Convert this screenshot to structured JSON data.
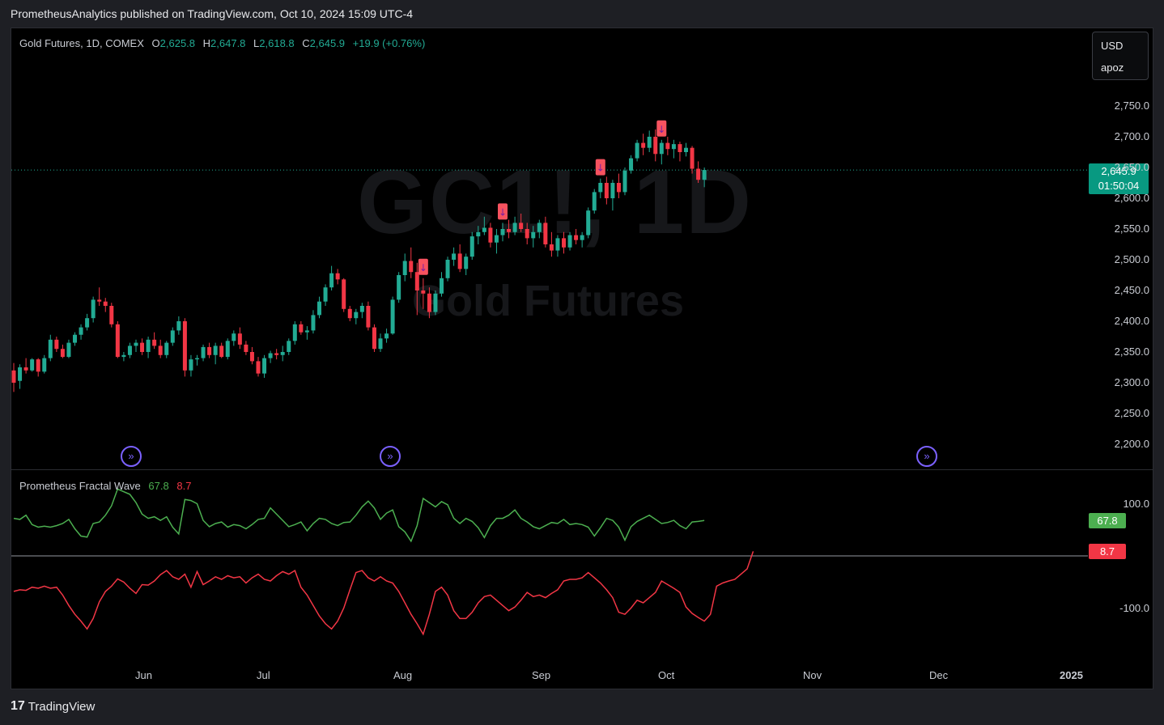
{
  "header": {
    "publish_text": "PrometheusAnalytics published on TradingView.com, Oct 10, 2024 15:09 UTC-4"
  },
  "legend": {
    "symbol": "Gold Futures, 1D, COMEX",
    "o_label": "O",
    "o": "2,625.8",
    "h_label": "H",
    "h": "2,647.8",
    "l_label": "L",
    "l": "2,618.8",
    "c_label": "C",
    "c": "2,645.9",
    "change": "+19.9 (+0.76%)"
  },
  "currency_box": {
    "currency": "USD",
    "mode": "apoz"
  },
  "watermark": {
    "ticker": "GC1!, 1D",
    "name": "Gold Futures"
  },
  "price_axis": [
    "2,750.0",
    "2,700.0",
    "2,650.0",
    "2,600.0",
    "2,550.0",
    "2,500.0",
    "2,450.0",
    "2,400.0",
    "2,350.0",
    "2,300.0",
    "2,250.0",
    "2,200.0"
  ],
  "last_price": {
    "value": "2,645.9",
    "countdown": "01:50:04"
  },
  "time_axis": [
    "Jun",
    "Jul",
    "Aug",
    "Sep",
    "Oct",
    "Nov",
    "Dec",
    "2025"
  ],
  "oscillator": {
    "name": "Prometheus Fractal Wave",
    "green_value": "67.8",
    "red_value": "8.7",
    "axis": [
      "100.0",
      "-100.0"
    ]
  },
  "footer": {
    "brand": "TradingView",
    "logo_text": "17"
  },
  "colors": {
    "up": "#22ab94",
    "down": "#f23645",
    "osc_green": "#4caf50",
    "osc_red": "#f23645",
    "marker": "#7b61ff",
    "zero_line": "#9598a1"
  },
  "chart_data": {
    "type": "candlestick",
    "price_range": [
      2180,
      2780
    ],
    "candles": [
      [
        2320,
        2332,
        2285,
        2300
      ],
      [
        2303,
        2330,
        2290,
        2325
      ],
      [
        2325,
        2340,
        2315,
        2320
      ],
      [
        2320,
        2340,
        2318,
        2338
      ],
      [
        2338,
        2340,
        2310,
        2318
      ],
      [
        2318,
        2345,
        2315,
        2340
      ],
      [
        2340,
        2378,
        2335,
        2370
      ],
      [
        2370,
        2375,
        2350,
        2355
      ],
      [
        2355,
        2362,
        2340,
        2342
      ],
      [
        2342,
        2370,
        2340,
        2365
      ],
      [
        2365,
        2382,
        2360,
        2378
      ],
      [
        2378,
        2395,
        2370,
        2390
      ],
      [
        2390,
        2412,
        2385,
        2405
      ],
      [
        2405,
        2440,
        2398,
        2435
      ],
      [
        2435,
        2455,
        2425,
        2432
      ],
      [
        2432,
        2438,
        2415,
        2425
      ],
      [
        2425,
        2430,
        2390,
        2395
      ],
      [
        2395,
        2400,
        2340,
        2342
      ],
      [
        2342,
        2350,
        2335,
        2345
      ],
      [
        2345,
        2365,
        2340,
        2360
      ],
      [
        2360,
        2370,
        2350,
        2365
      ],
      [
        2365,
        2372,
        2345,
        2350
      ],
      [
        2350,
        2375,
        2340,
        2370
      ],
      [
        2370,
        2382,
        2355,
        2360
      ],
      [
        2360,
        2370,
        2340,
        2345
      ],
      [
        2345,
        2368,
        2340,
        2365
      ],
      [
        2365,
        2390,
        2360,
        2385
      ],
      [
        2385,
        2408,
        2378,
        2400
      ],
      [
        2400,
        2405,
        2310,
        2320
      ],
      [
        2320,
        2345,
        2310,
        2338
      ],
      [
        2338,
        2345,
        2328,
        2340
      ],
      [
        2340,
        2362,
        2335,
        2358
      ],
      [
        2358,
        2365,
        2340,
        2345
      ],
      [
        2345,
        2365,
        2330,
        2360
      ],
      [
        2360,
        2365,
        2340,
        2342
      ],
      [
        2342,
        2372,
        2338,
        2368
      ],
      [
        2368,
        2385,
        2360,
        2380
      ],
      [
        2380,
        2390,
        2355,
        2362
      ],
      [
        2362,
        2368,
        2345,
        2350
      ],
      [
        2350,
        2358,
        2330,
        2335
      ],
      [
        2335,
        2342,
        2310,
        2315
      ],
      [
        2315,
        2345,
        2308,
        2340
      ],
      [
        2340,
        2352,
        2332,
        2348
      ],
      [
        2348,
        2355,
        2338,
        2345
      ],
      [
        2345,
        2360,
        2335,
        2350
      ],
      [
        2350,
        2372,
        2345,
        2368
      ],
      [
        2368,
        2400,
        2362,
        2395
      ],
      [
        2395,
        2400,
        2378,
        2382
      ],
      [
        2382,
        2392,
        2370,
        2385
      ],
      [
        2385,
        2418,
        2380,
        2410
      ],
      [
        2410,
        2440,
        2405,
        2432
      ],
      [
        2432,
        2460,
        2425,
        2455
      ],
      [
        2455,
        2490,
        2450,
        2478
      ],
      [
        2478,
        2485,
        2460,
        2468
      ],
      [
        2468,
        2470,
        2415,
        2420
      ],
      [
        2420,
        2425,
        2400,
        2405
      ],
      [
        2405,
        2420,
        2395,
        2415
      ],
      [
        2415,
        2430,
        2405,
        2425
      ],
      [
        2425,
        2432,
        2385,
        2390
      ],
      [
        2390,
        2395,
        2350,
        2355
      ],
      [
        2355,
        2380,
        2350,
        2372
      ],
      [
        2372,
        2388,
        2365,
        2380
      ],
      [
        2380,
        2440,
        2378,
        2435
      ],
      [
        2435,
        2480,
        2430,
        2475
      ],
      [
        2475,
        2510,
        2465,
        2498
      ],
      [
        2498,
        2520,
        2470,
        2480
      ],
      [
        2480,
        2495,
        2410,
        2450
      ],
      [
        2450,
        2470,
        2420,
        2445
      ],
      [
        2445,
        2455,
        2405,
        2415
      ],
      [
        2415,
        2450,
        2410,
        2445
      ],
      [
        2445,
        2480,
        2440,
        2470
      ],
      [
        2470,
        2505,
        2465,
        2500
      ],
      [
        2500,
        2520,
        2490,
        2510
      ],
      [
        2510,
        2525,
        2480,
        2485
      ],
      [
        2485,
        2510,
        2475,
        2505
      ],
      [
        2505,
        2545,
        2500,
        2538
      ],
      [
        2538,
        2555,
        2525,
        2545
      ],
      [
        2545,
        2570,
        2540,
        2552
      ],
      [
        2552,
        2560,
        2520,
        2528
      ],
      [
        2528,
        2550,
        2510,
        2540
      ],
      [
        2540,
        2560,
        2530,
        2550
      ],
      [
        2550,
        2565,
        2535,
        2545
      ],
      [
        2545,
        2570,
        2540,
        2560
      ],
      [
        2560,
        2575,
        2545,
        2550
      ],
      [
        2550,
        2560,
        2525,
        2535
      ],
      [
        2535,
        2555,
        2520,
        2545
      ],
      [
        2545,
        2565,
        2535,
        2560
      ],
      [
        2560,
        2570,
        2520,
        2525
      ],
      [
        2525,
        2545,
        2505,
        2515
      ],
      [
        2515,
        2540,
        2505,
        2535
      ],
      [
        2535,
        2545,
        2510,
        2520
      ],
      [
        2520,
        2545,
        2515,
        2540
      ],
      [
        2540,
        2550,
        2525,
        2532
      ],
      [
        2532,
        2545,
        2520,
        2540
      ],
      [
        2540,
        2585,
        2535,
        2580
      ],
      [
        2580,
        2615,
        2575,
        2610
      ],
      [
        2610,
        2632,
        2600,
        2625
      ],
      [
        2625,
        2635,
        2590,
        2600
      ],
      [
        2600,
        2630,
        2580,
        2625
      ],
      [
        2625,
        2640,
        2600,
        2610
      ],
      [
        2610,
        2650,
        2605,
        2645
      ],
      [
        2645,
        2670,
        2640,
        2665
      ],
      [
        2665,
        2695,
        2660,
        2690
      ],
      [
        2690,
        2705,
        2670,
        2682
      ],
      [
        2682,
        2710,
        2675,
        2700
      ],
      [
        2700,
        2712,
        2660,
        2672
      ],
      [
        2672,
        2695,
        2655,
        2690
      ],
      [
        2690,
        2700,
        2670,
        2680
      ],
      [
        2680,
        2695,
        2665,
        2688
      ],
      [
        2688,
        2692,
        2660,
        2675
      ],
      [
        2675,
        2690,
        2668,
        2682
      ],
      [
        2682,
        2685,
        2640,
        2648
      ],
      [
        2648,
        2660,
        2625,
        2630
      ],
      [
        2630,
        2650,
        2618,
        2646
      ]
    ],
    "signals": [
      {
        "index": 67,
        "label": "↓"
      },
      {
        "index": 80,
        "label": "↓"
      },
      {
        "index": 96,
        "label": "↓"
      },
      {
        "index": 106,
        "label": "↓"
      }
    ],
    "oscillator_green": [
      72,
      70,
      78,
      60,
      55,
      57,
      55,
      58,
      62,
      70,
      52,
      38,
      36,
      62,
      65,
      78,
      96,
      128,
      123,
      118,
      102,
      80,
      72,
      75,
      68,
      75,
      55,
      42,
      108,
      106,
      100,
      68,
      56,
      62,
      65,
      55,
      60,
      58,
      52,
      60,
      70,
      72,
      92,
      80,
      68,
      56,
      60,
      65,
      48,
      62,
      72,
      70,
      62,
      58,
      64,
      65,
      78,
      94,
      105,
      92,
      70,
      82,
      88,
      56,
      46,
      28,
      58,
      110,
      102,
      94,
      104,
      98,
      72,
      62,
      72,
      66,
      54,
      35,
      58,
      72,
      72,
      78,
      88,
      72,
      65,
      56,
      52,
      58,
      64,
      62,
      70,
      60,
      62,
      60,
      55,
      38,
      54,
      72,
      68,
      55,
      30,
      56,
      66,
      72,
      78,
      70,
      62,
      64,
      68,
      58,
      52,
      65,
      66,
      67.8
    ],
    "oscillator_red": [
      -68,
      -65,
      -66,
      -60,
      -62,
      -58,
      -62,
      -60,
      -75,
      -95,
      -112,
      -125,
      -140,
      -120,
      -88,
      -68,
      -58,
      -44,
      -50,
      -62,
      -72,
      -55,
      -56,
      -48,
      -36,
      -28,
      -40,
      -45,
      -35,
      -60,
      -30,
      -55,
      -48,
      -40,
      -45,
      -38,
      -42,
      -40,
      -52,
      -42,
      -35,
      -45,
      -48,
      -38,
      -30,
      -35,
      -28,
      -60,
      -75,
      -95,
      -115,
      -130,
      -140,
      -125,
      -100,
      -65,
      -32,
      -28,
      -42,
      -48,
      -40,
      -48,
      -52,
      -68,
      -90,
      -112,
      -130,
      -150,
      -112,
      -68,
      -60,
      -75,
      -105,
      -120,
      -120,
      -108,
      -90,
      -78,
      -75,
      -85,
      -95,
      -105,
      -98,
      -85,
      -70,
      -78,
      -75,
      -80,
      -72,
      -65,
      -48,
      -45,
      -45,
      -42,
      -32,
      -42,
      -52,
      -65,
      -80,
      -108,
      -112,
      -100,
      -85,
      -90,
      -80,
      -70,
      -48,
      -55,
      -62,
      -70,
      -98,
      -110,
      -118,
      -125,
      -112,
      -58,
      -52,
      -48,
      -45,
      -35,
      -25,
      8.7
    ]
  }
}
